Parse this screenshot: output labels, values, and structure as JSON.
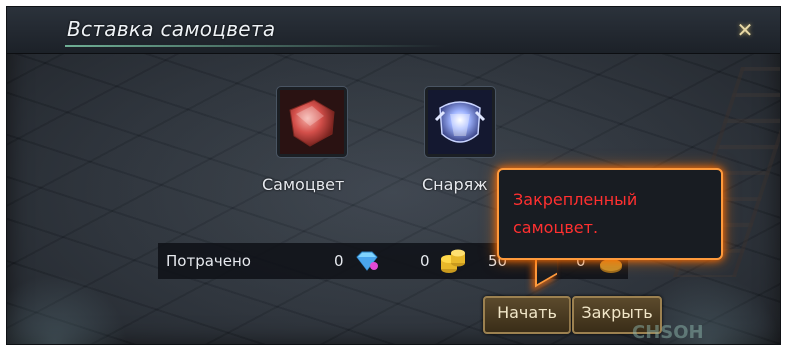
{
  "window": {
    "title": "Вставка самоцвета",
    "close_icon": "close-x-icon"
  },
  "slots": {
    "gem": {
      "label": "Самоцвет",
      "icon": "red-gem-icon"
    },
    "gear": {
      "label": "Снаряж",
      "icon": "armor-icon"
    }
  },
  "cost": {
    "label": "Потрачено",
    "values": [
      {
        "value": "0",
        "icon": "diamond-currency-icon"
      },
      {
        "value": "0",
        "icon": "gold-coins-icon"
      },
      {
        "value": "50",
        "icon": "silver-icon"
      },
      {
        "value": "0",
        "icon": "copper-icon"
      }
    ]
  },
  "buttons": {
    "start": "Начать",
    "close": "Закрыть"
  },
  "tooltip": {
    "line1": "Закрепленный",
    "line2": "самоцвет."
  },
  "watermark": "CHSOH",
  "colors": {
    "tooltip_border": "#ff9a3c",
    "tooltip_text": "#ff3030",
    "title_accent": "#78bea0"
  }
}
